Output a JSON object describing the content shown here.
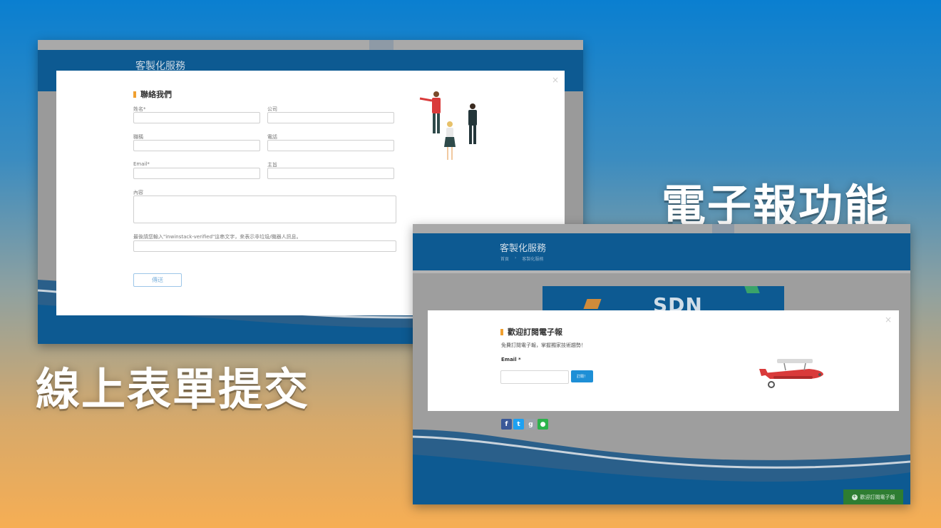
{
  "headlines": {
    "newsletter": "電子報功能",
    "form": "線上表單提交"
  },
  "contact_page": {
    "header_title": "客製化服務",
    "close_glyph": "×",
    "section_title": "聯絡我們",
    "fields": {
      "name_label": "姓名*",
      "company_label": "公司",
      "title_label": "職稱",
      "phone_label": "電話",
      "email_label": "Email*",
      "subject_label": "主旨",
      "content_label": "內容",
      "verify_label": "最後請您輸入\"inwinstack-verified\"這串文字，來表示非垃圾/機器人訊息。"
    },
    "submit_label": "傳送"
  },
  "newsletter_page": {
    "header_title": "客製化服務",
    "breadcrumb": {
      "home": "首頁",
      "separator": "›",
      "current": "客製化服務"
    },
    "banner_text": "SDN",
    "close_glyph": "×",
    "section_title": "歡迎訂閱電子報",
    "description": "免費訂閱電子報，掌握獨家技術趨勢！",
    "email_label": "Email *",
    "subscribe_button": "訂閱！",
    "social_icons": [
      "facebook-icon",
      "twitter-icon",
      "google-plus-icon",
      "line-icon"
    ],
    "floating_tab": "歡迎訂閱電子報"
  },
  "colors": {
    "brand_blue": "#0d5a92",
    "accent_orange": "#f0a030",
    "button_blue": "#1e8fd6",
    "tab_green": "#2e7d32"
  }
}
